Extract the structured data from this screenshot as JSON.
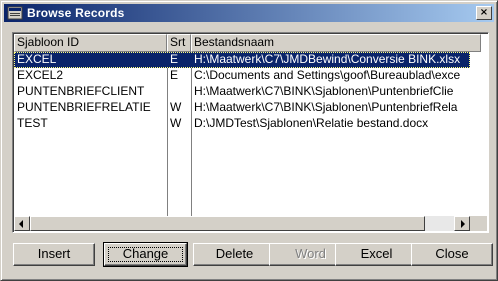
{
  "window": {
    "title": "Browse Records",
    "close_glyph": "×"
  },
  "table": {
    "headers": [
      "Sjabloon ID",
      "Srt",
      "Bestandsnaam"
    ],
    "rows": [
      {
        "id": "EXCEL",
        "srt": "E",
        "file": "H:\\Maatwerk\\C7\\JMDBewind\\Conversie BINK.xlsx",
        "selected": true
      },
      {
        "id": "EXCEL2",
        "srt": "E",
        "file": "C:\\Documents and Settings\\goof\\Bureaublad\\exce",
        "selected": false
      },
      {
        "id": "PUNTENBRIEFCLIENT",
        "srt": "",
        "file": "H:\\Maatwerk\\C7\\BINK\\Sjablonen\\PuntenbriefClie",
        "selected": false
      },
      {
        "id": "PUNTENBRIEFRELATIE",
        "srt": "W",
        "file": "H:\\Maatwerk\\C7\\BINK\\Sjablonen\\PuntenbriefRela",
        "selected": false
      },
      {
        "id": "TEST",
        "srt": "W",
        "file": "D:\\JMDTest\\Sjablonen\\Relatie bestand.docx",
        "selected": false
      }
    ]
  },
  "buttons": {
    "insert": "Insert",
    "change": "Change",
    "delete": "Delete",
    "word": "Word",
    "excel": "Excel",
    "close": "Close"
  },
  "colors": {
    "titlebar_start": "#0a246a",
    "titlebar_end": "#a6caf0",
    "selection": "#0a246a",
    "face": "#d4d0c8"
  }
}
